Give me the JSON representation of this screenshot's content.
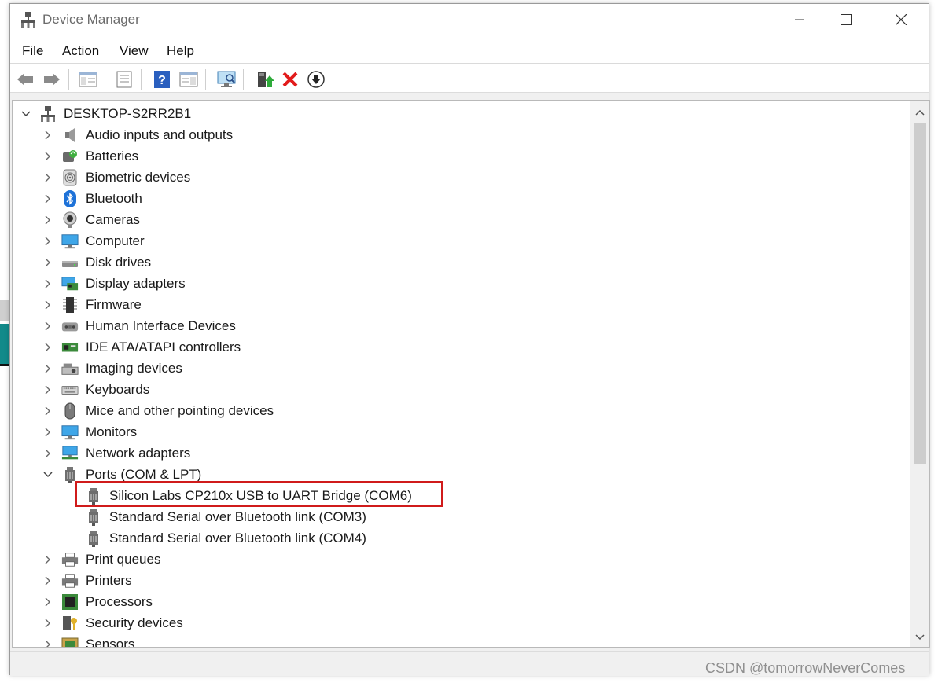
{
  "window": {
    "title": "Device Manager",
    "controls": {
      "minimize": "—",
      "maximize": "☐",
      "close": "✕"
    }
  },
  "menu": [
    "File",
    "Action",
    "View",
    "Help"
  ],
  "toolbar": [
    {
      "name": "back-icon"
    },
    {
      "name": "forward-icon"
    },
    {
      "name": "show-hide-console-tree-icon"
    },
    {
      "name": "properties-icon"
    },
    {
      "name": "help-icon"
    },
    {
      "name": "show-action-pane-icon"
    },
    {
      "name": "scan-for-hardware-changes-icon"
    },
    {
      "name": "update-driver-icon"
    },
    {
      "name": "uninstall-device-icon"
    },
    {
      "name": "disable-device-icon"
    }
  ],
  "tree": {
    "root": "DESKTOP-S2RR2B1",
    "categories": [
      "Audio inputs and outputs",
      "Batteries",
      "Biometric devices",
      "Bluetooth",
      "Cameras",
      "Computer",
      "Disk drives",
      "Display adapters",
      "Firmware",
      "Human Interface Devices",
      "IDE ATA/ATAPI controllers",
      "Imaging devices",
      "Keyboards",
      "Mice and other pointing devices",
      "Monitors",
      "Network adapters",
      "Ports (COM & LPT)"
    ],
    "ports_children": [
      "Silicon Labs CP210x USB to UART Bridge (COM6)",
      "Standard Serial over Bluetooth link (COM3)",
      "Standard Serial over Bluetooth link (COM4)"
    ],
    "categories_after": [
      "Print queues",
      "Printers",
      "Processors",
      "Security devices",
      "Sensors"
    ]
  },
  "highlight_color": "#d01b1b",
  "watermark": "CSDN @tomorrowNeverComes"
}
